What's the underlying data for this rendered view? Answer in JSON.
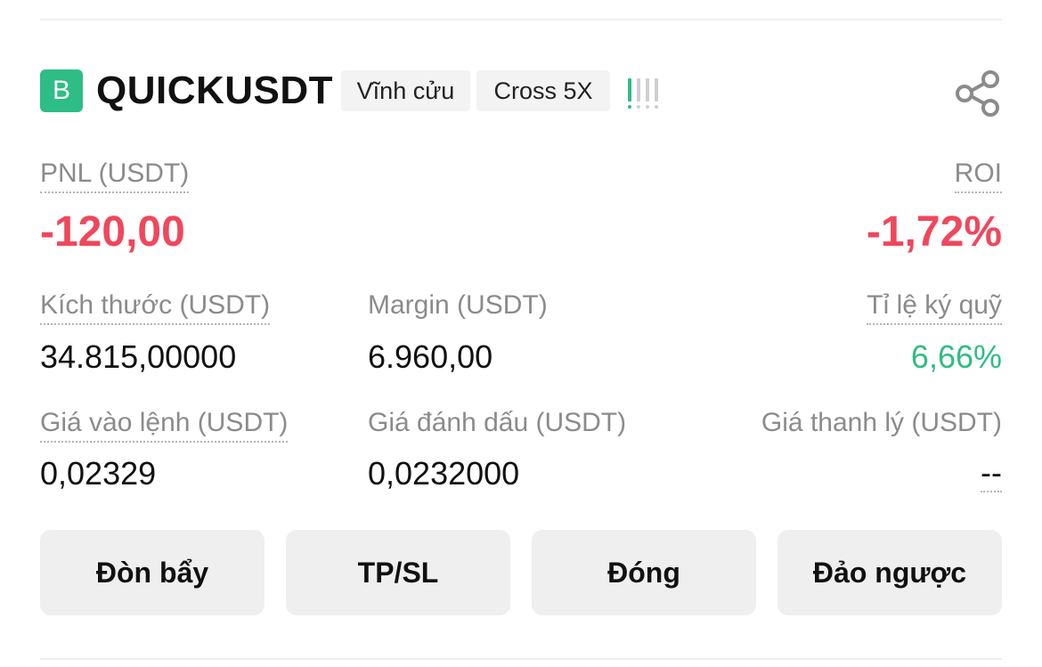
{
  "position": {
    "side_badge": "B",
    "symbol": "QUICKUSDT",
    "contract_type": "Vĩnh cửu",
    "margin_mode": "Cross 5X",
    "adl_level": 1,
    "share_icon": "share-icon"
  },
  "pnl": {
    "label": "PNL (USDT)",
    "value": "-120,00"
  },
  "roi": {
    "label": "ROI",
    "value": "-1,72%"
  },
  "size": {
    "label": "Kích thước (USDT)",
    "value": "34.815,00000"
  },
  "margin": {
    "label": "Margin (USDT)",
    "value": "6.960,00"
  },
  "margin_ratio": {
    "label": "Tỉ lệ ký quỹ",
    "value": "6,66%"
  },
  "entry_price": {
    "label": "Giá vào lệnh (USDT)",
    "value": "0,02329"
  },
  "mark_price": {
    "label": "Giá đánh dấu (USDT)",
    "value": "0,0232000"
  },
  "liq_price": {
    "label": "Giá thanh lý (USDT)",
    "value": "--"
  },
  "actions": {
    "leverage": "Đòn bẩy",
    "tpsl": "TP/SL",
    "close": "Đóng",
    "reverse": "Đảo ngược"
  },
  "colors": {
    "buy_green": "#2ebd85",
    "sell_red": "#f0475c",
    "muted": "#8b8b8b",
    "adl_inactive": "#cfcfcf"
  }
}
